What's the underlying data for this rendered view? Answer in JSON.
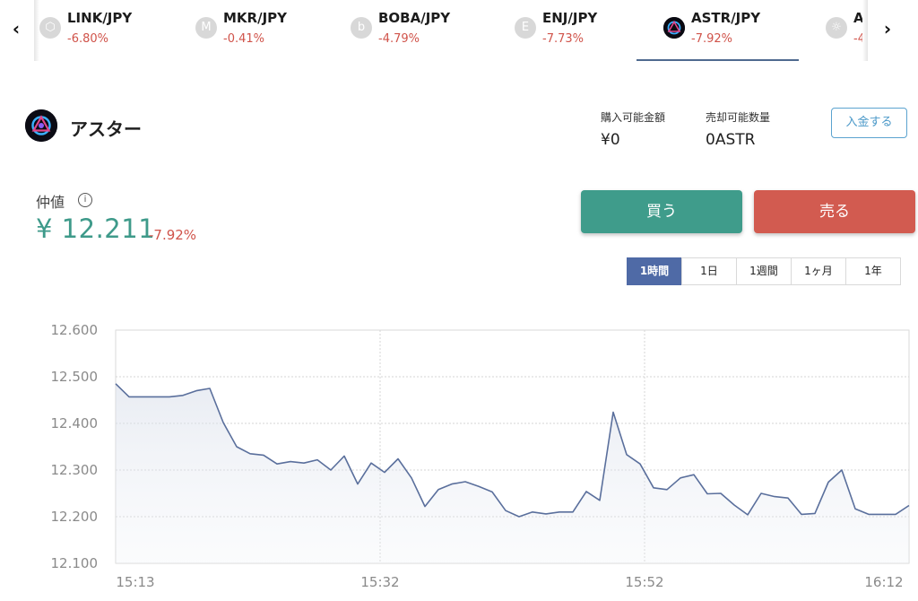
{
  "ticker": {
    "items": [
      {
        "icon": "link-coin-icon",
        "glyph": "⬡",
        "pair": "LINK/JPY",
        "change": "-6.80%"
      },
      {
        "icon": "mkr-coin-icon",
        "glyph": "M",
        "pair": "MKR/JPY",
        "change": "-0.41%"
      },
      {
        "icon": "boba-coin-icon",
        "glyph": "b",
        "pair": "BOBA/JPY",
        "change": "-4.79%"
      },
      {
        "icon": "enj-coin-icon",
        "glyph": "E",
        "pair": "ENJ/JPY",
        "change": "-7.73%"
      },
      {
        "icon": "astr-coin-icon",
        "glyph": "",
        "pair": "ASTR/JPY",
        "change": "-7.92%"
      },
      {
        "icon": "next-coin-icon",
        "glyph": "☼",
        "pair": "A",
        "change": "-4"
      }
    ],
    "selected": "ASTR/JPY"
  },
  "coin": {
    "name": "アスター",
    "buy_available_label": "購入可能金額",
    "buy_available_value": "¥0",
    "sell_available_label": "売却可能数量",
    "sell_available_value": "0ASTR",
    "deposit_label": "入金する"
  },
  "price": {
    "label": "仲値",
    "value": "¥ 12.211",
    "change": "-7.92%"
  },
  "actions": {
    "buy_label": "買う",
    "sell_label": "売る"
  },
  "tabs": {
    "options": [
      "1時間",
      "1日",
      "1週間",
      "1ヶ月",
      "1年"
    ],
    "selected": "1時間"
  },
  "colors": {
    "accent_green": "#3f9c8b",
    "accent_red": "#d25b50",
    "tab_active": "#4f6aa6",
    "line": "#5a6f9c"
  },
  "chart_data": {
    "type": "area",
    "ylim": [
      12.1,
      12.6
    ],
    "y_ticks": [
      "12.600",
      "12.500",
      "12.400",
      "12.300",
      "12.200",
      "12.100"
    ],
    "x_tick_labels": [
      "15:13",
      "15:32",
      "15:52",
      "16:12"
    ],
    "grid": true,
    "values": [
      12.485,
      12.457,
      12.457,
      12.457,
      12.457,
      12.46,
      12.47,
      12.475,
      12.402,
      12.35,
      12.335,
      12.332,
      12.313,
      12.318,
      12.315,
      12.322,
      12.3,
      12.33,
      12.27,
      12.315,
      12.295,
      12.324,
      12.283,
      12.222,
      12.258,
      12.27,
      12.275,
      12.265,
      12.253,
      12.213,
      12.2,
      12.21,
      12.206,
      12.21,
      12.21,
      12.254,
      12.235,
      12.424,
      12.333,
      12.313,
      12.262,
      12.258,
      12.283,
      12.29,
      12.249,
      12.25,
      12.225,
      12.204,
      12.25,
      12.243,
      12.24,
      12.205,
      12.207,
      12.274,
      12.3,
      12.217,
      12.205,
      12.205,
      12.205,
      12.224
    ]
  }
}
